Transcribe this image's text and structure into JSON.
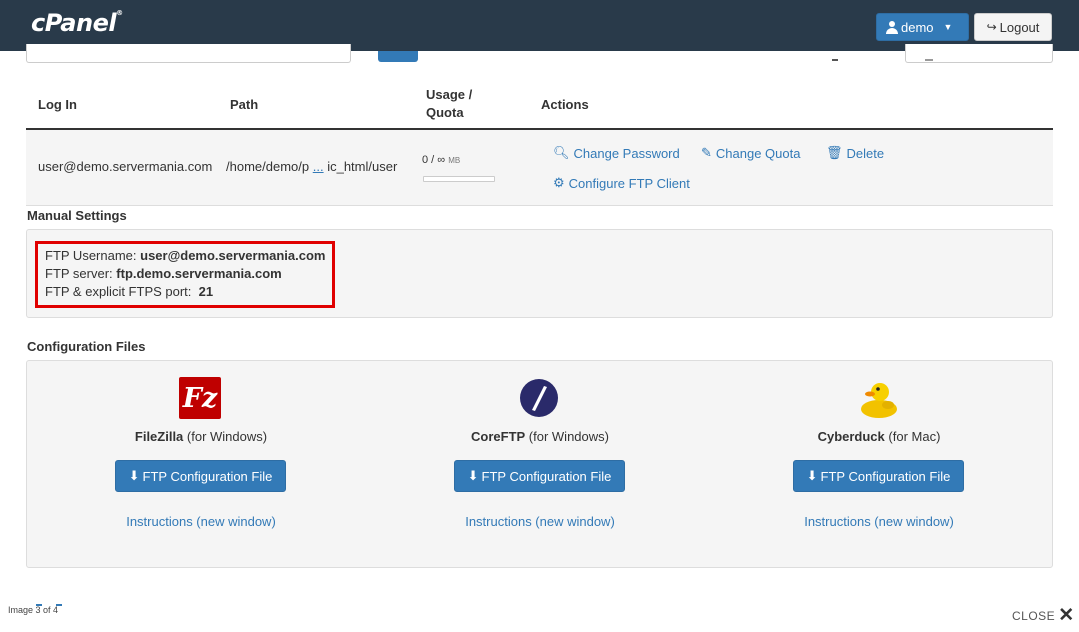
{
  "header": {
    "logo": "cPanel",
    "user_button": "demo",
    "logout_button": "Logout"
  },
  "table": {
    "columns": [
      "Log In",
      "Path",
      "Usage /",
      "Quota",
      "Actions"
    ],
    "row": {
      "login": "user@demo.servermania.com",
      "path_start": "/home/demo/p",
      "path_ellipsis": "...",
      "path_end": "ic_html/user",
      "usage": "0 / ∞",
      "usage_unit": "MB",
      "usage_fraction": 0,
      "actions": {
        "change_password": "Change Password",
        "change_quota": "Change Quota",
        "delete": "Delete",
        "configure": "Configure FTP Client"
      }
    }
  },
  "manual_settings": {
    "title": "Manual Settings",
    "username_label": "FTP Username: ",
    "username_value": "user@demo.servermania.com",
    "server_label": "FTP server: ",
    "server_value": "ftp.demo.servermania.com",
    "port_label": "FTP & explicit FTPS port:  ",
    "port_value": "21"
  },
  "config_files": {
    "title": "Configuration Files",
    "clients": [
      {
        "name": "FileZilla",
        "platform": " (for Windows)",
        "button": "FTP Configuration File",
        "instructions": "Instructions (new window)",
        "icon": "filezilla-icon"
      },
      {
        "name": "CoreFTP",
        "platform": " (for Windows)",
        "button": "FTP Configuration File",
        "instructions": "Instructions (new window)",
        "icon": "coreftp-icon"
      },
      {
        "name": "Cyberduck",
        "platform": " (for Mac)",
        "button": "FTP Configuration File",
        "instructions": "Instructions (new window)",
        "icon": "cyberduck-icon"
      }
    ]
  },
  "viewer": {
    "counter": "Image 3 of 4",
    "close": "CLOSE"
  },
  "colors": {
    "header_bg": "#293a4a",
    "primary": "#337ab7",
    "highlight": "#e00000"
  }
}
